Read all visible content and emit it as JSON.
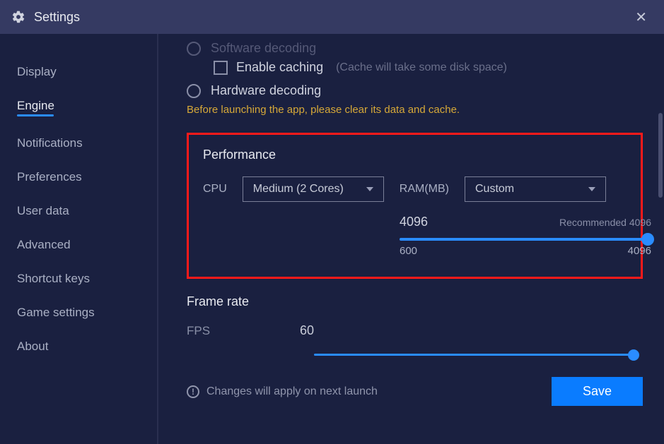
{
  "titlebar": {
    "title": "Settings"
  },
  "sidebar": {
    "items": [
      {
        "label": "Display"
      },
      {
        "label": "Engine"
      },
      {
        "label": "Notifications"
      },
      {
        "label": "Preferences"
      },
      {
        "label": "User data"
      },
      {
        "label": "Advanced"
      },
      {
        "label": "Shortcut keys"
      },
      {
        "label": "Game settings"
      },
      {
        "label": "About"
      }
    ],
    "active_index": 1
  },
  "decoding": {
    "software_label": "Software decoding",
    "enable_caching_label": "Enable caching",
    "cache_hint": "(Cache will take some disk space)",
    "hardware_label": "Hardware decoding",
    "warning": "Before launching the app, please clear its data and cache."
  },
  "performance": {
    "section_title": "Performance",
    "cpu_label": "CPU",
    "cpu_value": "Medium (2 Cores)",
    "ram_label": "RAM(MB)",
    "ram_select_value": "Custom",
    "ram_current": "4096",
    "ram_recommended": "Recommended 4096",
    "ram_min": "600",
    "ram_max": "4096"
  },
  "framerate": {
    "section_title": "Frame rate",
    "fps_label": "FPS",
    "fps_value": "60"
  },
  "footer": {
    "notice": "Changes will apply on next launch",
    "save_label": "Save"
  }
}
